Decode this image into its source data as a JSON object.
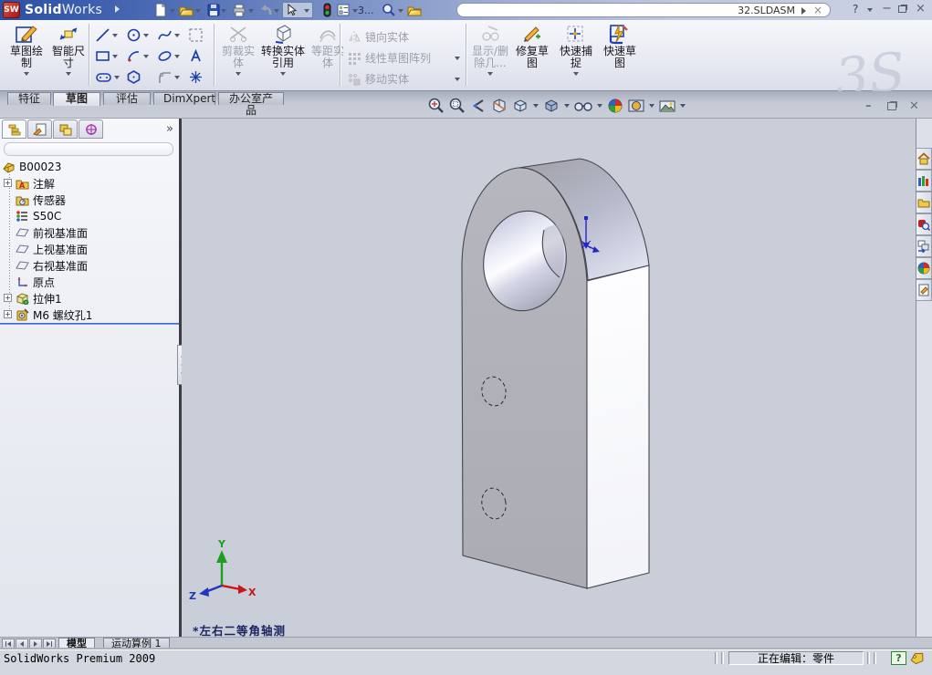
{
  "colors": {
    "titlebar_blue": "#2b4fa4",
    "viewport_bg": "#c9ced9",
    "rollback_blue": "#3a6ad4",
    "sketch_blue": "#1f3fa8"
  },
  "titlebar": {
    "brand_bold": "Solid",
    "brand_light": "Works",
    "overflow_label": "3...",
    "doc_name": "32.SLDASM",
    "doc_close": "×",
    "help": "?",
    "minimize": "−",
    "close": "×"
  },
  "ribbon": {
    "watermark": "3S",
    "g1": [
      {
        "label": "草图绘制"
      },
      {
        "label": "智能尺寸"
      }
    ],
    "g3": [
      {
        "label": "剪裁实体"
      },
      {
        "label": "转换实体引用"
      },
      {
        "label": "等距实体"
      }
    ],
    "g4": [
      {
        "label": "镜向实体"
      },
      {
        "label": "线性草图阵列"
      },
      {
        "label": "移动实体"
      }
    ],
    "g5": [
      {
        "label": "显示/删除几..."
      },
      {
        "label": "修复草图"
      },
      {
        "label": "快速捕捉"
      },
      {
        "label": "快速草图"
      }
    ]
  },
  "tabs": [
    {
      "label": "特征"
    },
    {
      "label": "草图"
    },
    {
      "label": "评估"
    },
    {
      "label": "DimXpert"
    },
    {
      "label": "办公室产品"
    }
  ],
  "panel": {
    "collapse": "»",
    "expand_glyph": "+"
  },
  "tree": {
    "root": "B00023",
    "items": [
      "注解",
      "传感器",
      "S50C",
      "前视基准面",
      "上视基准面",
      "右视基准面",
      "原点",
      "拉伸1",
      "M6 螺纹孔1"
    ]
  },
  "viewport": {
    "view_label": "*左右二等角轴测",
    "triad": {
      "x": "X",
      "y": "Y",
      "z": "Z"
    }
  },
  "bottom": {
    "tabs": [
      {
        "label": "模型"
      },
      {
        "label": "运动算例 1"
      }
    ]
  },
  "status": {
    "left": "SolidWorks Premium 2009",
    "mode": "正在编辑：零件",
    "help": "?"
  }
}
